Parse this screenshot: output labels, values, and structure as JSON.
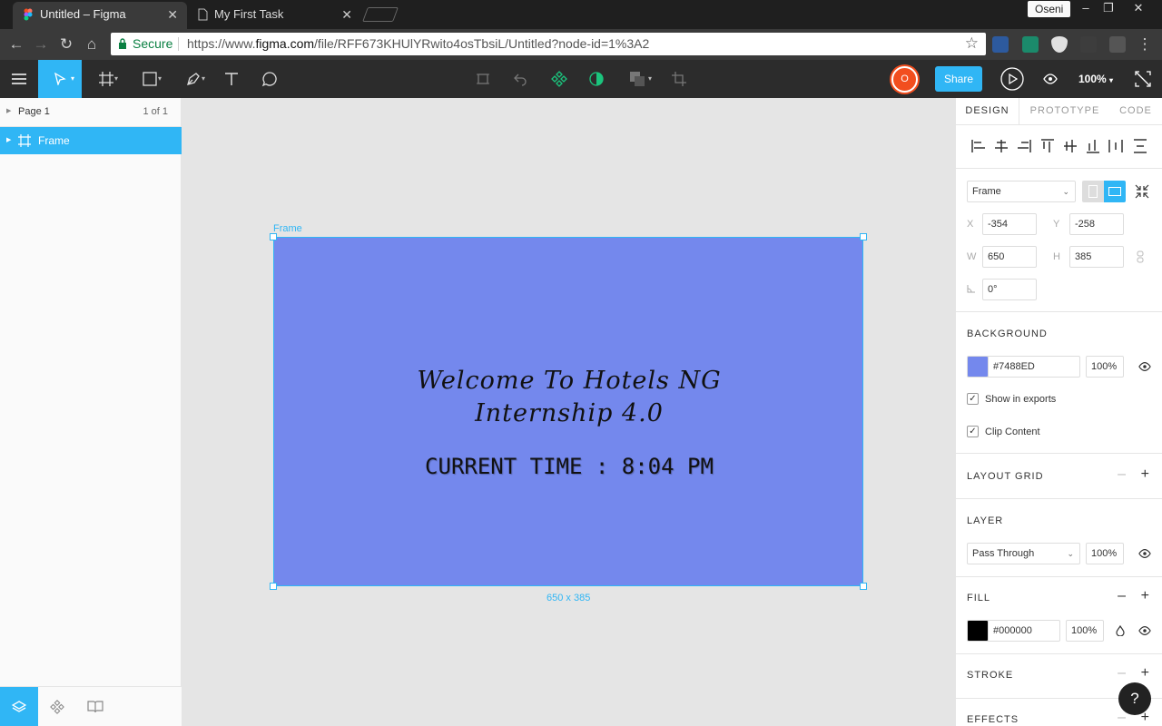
{
  "browser": {
    "tabs": [
      {
        "title": "Untitled – Figma",
        "active": true
      },
      {
        "title": "My First Task",
        "active": false
      }
    ],
    "profile": "Oseni",
    "address": {
      "secure_label": "Secure",
      "url_scheme": "https://www.",
      "url_host": "figma.com",
      "url_path": "/file/RFF673KHUlYRwito4osTbsiL/Untitled?node-id=1%3A2"
    }
  },
  "figma": {
    "user_initial": "O",
    "share_label": "Share",
    "zoom": "100%",
    "pages": {
      "name": "Page 1",
      "count": "1 of 1"
    },
    "layers": [
      {
        "name": "Frame"
      }
    ],
    "canvas": {
      "frame_label": "Frame",
      "welcome_line1": "Welcome To Hotels NG",
      "welcome_line2": "Internship 4.0",
      "current_time": "CURRENT TIME : 8:04 PM",
      "dimensions_label": "650 x 385",
      "frame_color": "#7488ED"
    },
    "inspector": {
      "tabs": [
        "DESIGN",
        "PROTOTYPE",
        "CODE"
      ],
      "frame_type": "Frame",
      "x_label": "X",
      "x": "-354",
      "y_label": "Y",
      "y": "-258",
      "w_label": "W",
      "w": "650",
      "h_label": "H",
      "h": "385",
      "rotation": "0°",
      "background_title": "BACKGROUND",
      "background_hex": "#7488ED",
      "background_opacity": "100%",
      "show_in_exports": "Show in exports",
      "clip_content": "Clip Content",
      "layout_grid_title": "LAYOUT GRID",
      "layer_title": "LAYER",
      "blend_mode": "Pass Through",
      "layer_opacity": "100%",
      "fill_title": "FILL",
      "fill_hex": "#000000",
      "fill_opacity": "100%",
      "stroke_title": "STROKE",
      "effects_title": "EFFECTS"
    },
    "help": "?"
  },
  "colors": {
    "accent": "#30B6F5",
    "frame": "#7488ED",
    "avatar": "#F24E1E"
  }
}
